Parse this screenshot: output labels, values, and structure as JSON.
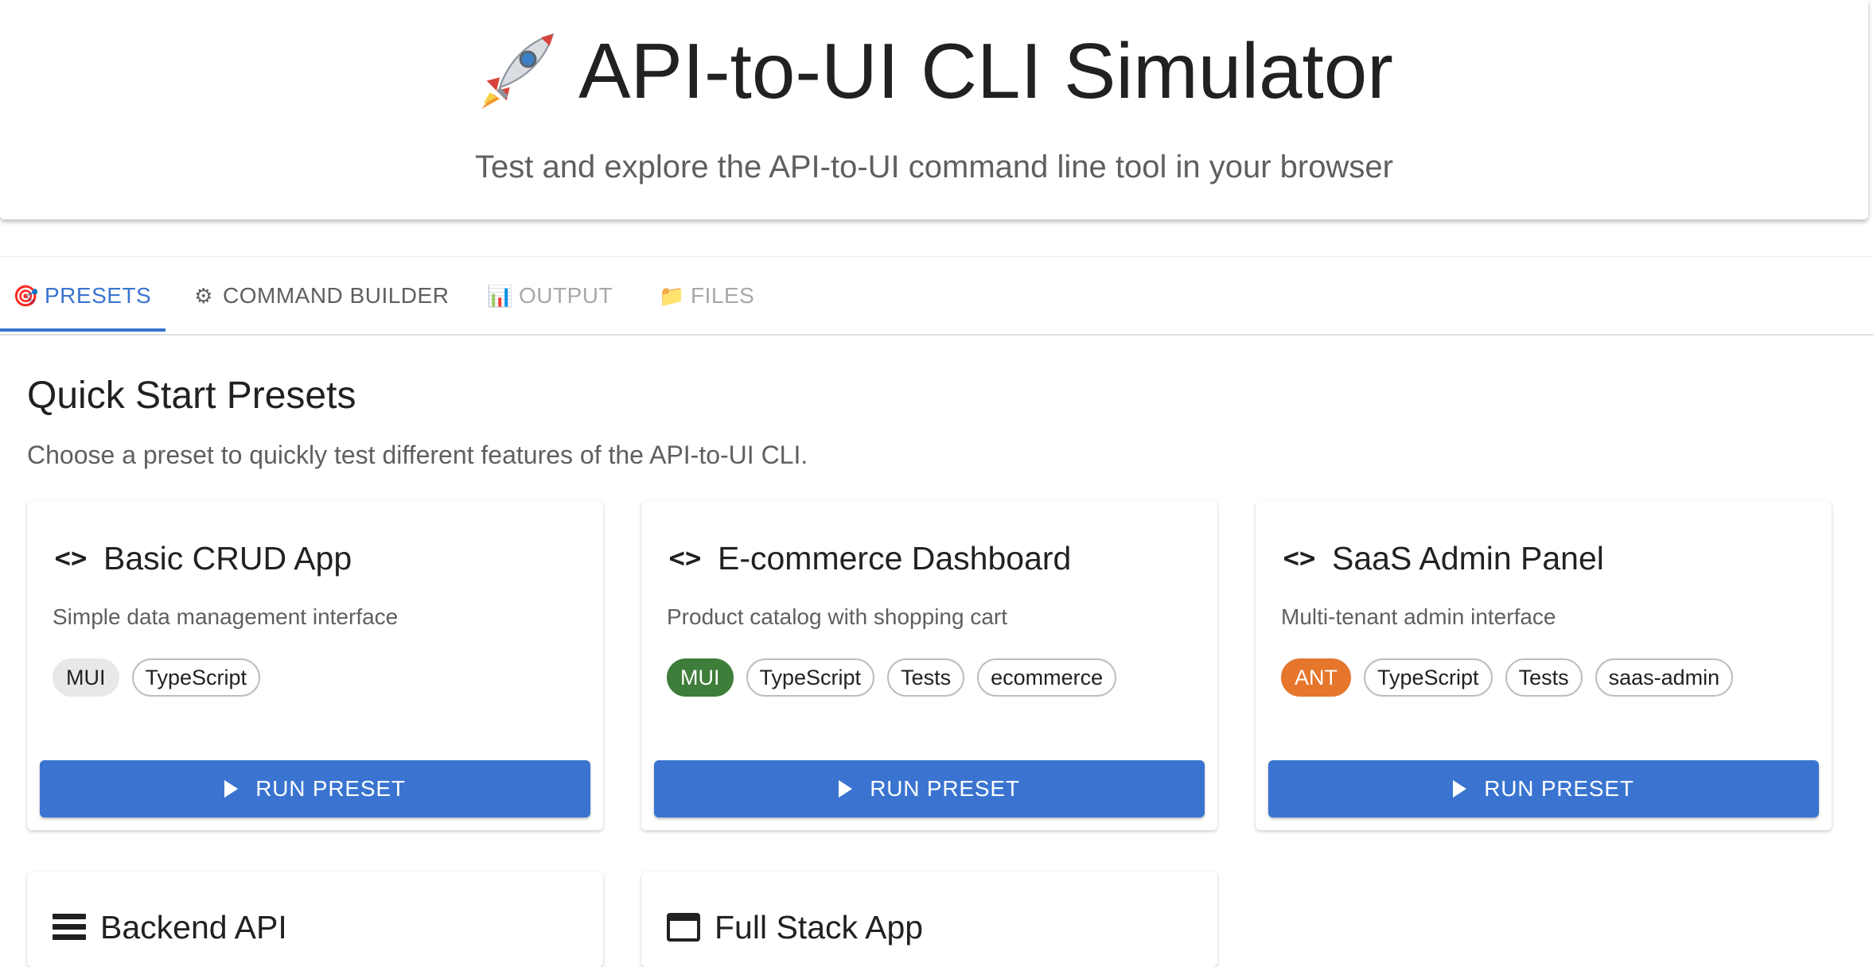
{
  "header": {
    "title": "API-to-UI CLI Simulator",
    "title_icon": "rocket-icon",
    "subtitle": "Test and explore the API-to-UI command line tool in your browser"
  },
  "tabs": [
    {
      "label": "PRESETS",
      "icon": "🎯",
      "state": "active"
    },
    {
      "label": "COMMAND BUILDER",
      "icon": "⚙",
      "state": "normal"
    },
    {
      "label": "OUTPUT",
      "icon": "📊",
      "state": "disabled"
    },
    {
      "label": "FILES",
      "icon": "📁",
      "state": "disabled"
    }
  ],
  "section": {
    "title": "Quick Start Presets",
    "description": "Choose a preset to quickly test different features of the API-to-UI CLI."
  },
  "presets": [
    {
      "title": "Basic CRUD App",
      "icon": "code-icon",
      "description": "Simple data management interface",
      "chips": [
        "MUI",
        "TypeScript"
      ],
      "button": "RUN PRESET"
    },
    {
      "title": "E-commerce Dashboard",
      "icon": "code-icon",
      "description": "Product catalog with shopping cart",
      "chips": [
        "MUI",
        "TypeScript",
        "Tests",
        "ecommerce"
      ],
      "button": "RUN PRESET"
    },
    {
      "title": "SaaS Admin Panel",
      "icon": "code-icon",
      "description": "Multi-tenant admin interface",
      "chips": [
        "ANT",
        "TypeScript",
        "Tests",
        "saas-admin"
      ],
      "button": "RUN PRESET"
    },
    {
      "title": "Backend API",
      "icon": "list-icon"
    },
    {
      "title": "Full Stack App",
      "icon": "web-icon"
    }
  ],
  "colors": {
    "primary": "#3a74d0",
    "mui_green": "#3f7d3a",
    "ant_orange": "#e5762c",
    "chip_grey": "#e8e8e8"
  }
}
